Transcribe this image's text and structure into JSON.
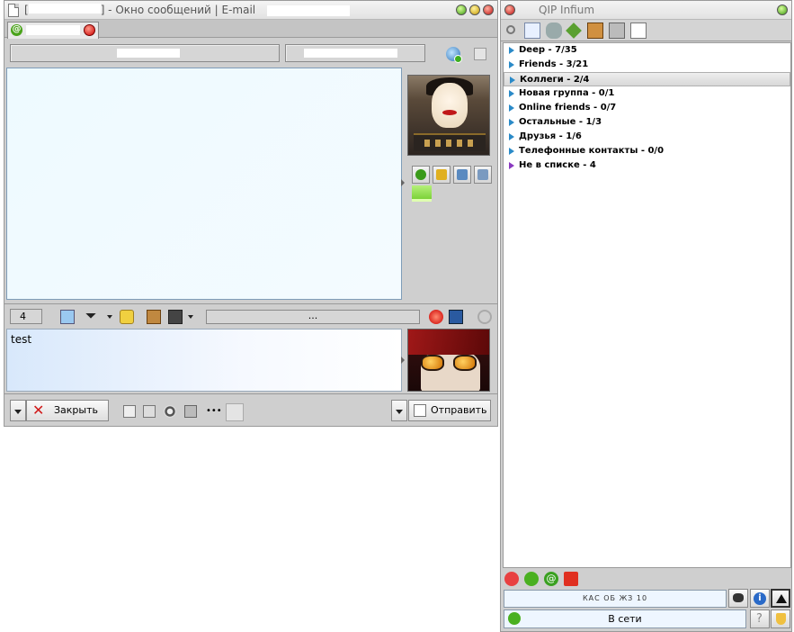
{
  "message_window": {
    "title_prefix": "[",
    "title_suffix": "] - Окно сообщений | E-mail",
    "char_count": "4",
    "progress_text": "...",
    "input_text": "test",
    "close_label": "Закрыть",
    "send_label": "Отправить"
  },
  "contact_list": {
    "title": "QIP Infium",
    "groups": [
      {
        "label": "Deep - 7/35"
      },
      {
        "label": "Friends - 3/21"
      },
      {
        "label": "Коллеги - 2/4"
      },
      {
        "label": "Новая группа - 0/1"
      },
      {
        "label": "Online friends - 0/7"
      },
      {
        "label": "Остальные - 1/3"
      },
      {
        "label": "Друзья - 1/6"
      },
      {
        "label": "Телефонные контакты - 0/0"
      },
      {
        "label": "Не в списке - 4"
      }
    ],
    "status_bar_text": "КАС ОБ ЖЗ 10",
    "status_text": "В сети"
  },
  "colors": {
    "window_bg": "#cfcfcf",
    "history_bg": "#eefaff",
    "group_arrow": "#2a8ac8",
    "not_in_list_arrow": "#8a3ac0"
  }
}
